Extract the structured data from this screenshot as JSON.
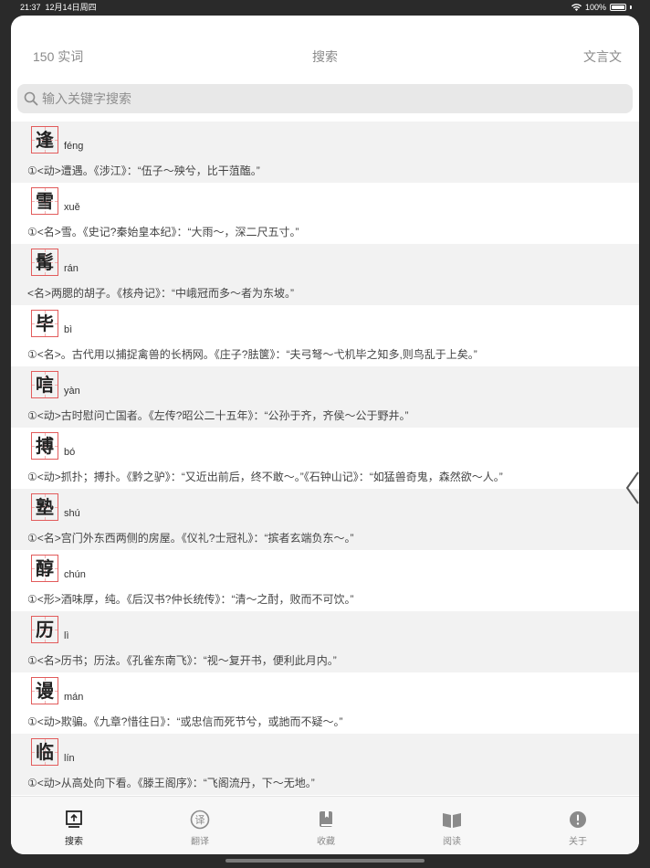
{
  "status": {
    "time": "21:37",
    "date": "12月14日周四",
    "battery": "100%"
  },
  "nav": {
    "left": "150 实词",
    "title": "搜索",
    "right": "文言文"
  },
  "search": {
    "placeholder": "输入关键字搜索",
    "value": ""
  },
  "entries": [
    {
      "char": "逢",
      "pinyin": "féng",
      "def": "①<动>遭遇。《涉江》：“伍子～殃兮，比干菹醢。”"
    },
    {
      "char": "雪",
      "pinyin": "xuě",
      "def": "①<名>雪。《史记?秦始皇本纪》：“大雨～，深二尺五寸。”"
    },
    {
      "char": "髯",
      "pinyin": "rán",
      "def": "<名>两腮的胡子。《核舟记》：“中峨冠而多～者为东坡。”"
    },
    {
      "char": "毕",
      "pinyin": "bì",
      "def": "①<名>。古代用以捕捉禽兽的长柄网。《庄子?胠箧》：“夫弓弩～弋机毕之知多,则鸟乱于上矣。”"
    },
    {
      "char": "唁",
      "pinyin": "yàn",
      "def": "①<动>古时慰问亡国者。《左传?昭公二十五年》：“公孙于齐，齐侯～公于野井。”"
    },
    {
      "char": "搏",
      "pinyin": "bó",
      "def": "①<动>抓扑；搏扑。《黔之驴》：“又近出前后，终不敢～。”《石钟山记》：“如猛兽奇鬼，森然欲～人。”"
    },
    {
      "char": "塾",
      "pinyin": "shú",
      "def": "①<名>宫门外东西两侧的房屋。《仪礼?士冠礼》：“摈者玄端负东～。”"
    },
    {
      "char": "醇",
      "pinyin": "chún",
      "def": "①<形>酒味厚，纯。《后汉书?仲长统传》：“清～之酎，败而不可饮。”"
    },
    {
      "char": "历",
      "pinyin": "lì",
      "def": "①<名>历书；历法。《孔雀东南飞》：“视～复开书，便利此月内。”"
    },
    {
      "char": "谩",
      "pinyin": "mán",
      "def": "①<动>欺骗。《九章?惜往日》：“或忠信而死节兮，或訑而不疑～。”"
    },
    {
      "char": "临",
      "pinyin": "lín",
      "def": "①<动>从高处向下看。《滕王阁序》：“飞阁流丹，下～无地。”"
    }
  ],
  "tabs": [
    {
      "label": "搜索",
      "icon": "search-tab-icon",
      "active": true
    },
    {
      "label": "翻译",
      "icon": "translate-icon",
      "active": false
    },
    {
      "label": "收藏",
      "icon": "bookmark-book-icon",
      "active": false
    },
    {
      "label": "阅读",
      "icon": "open-book-icon",
      "active": false
    },
    {
      "label": "关于",
      "icon": "info-icon",
      "active": false
    }
  ],
  "colors": {
    "accent_red": "#e25b5b",
    "row_alt": "#f2f2f2",
    "tab_active": "#222222",
    "tab_inactive": "#8a8a8a"
  }
}
